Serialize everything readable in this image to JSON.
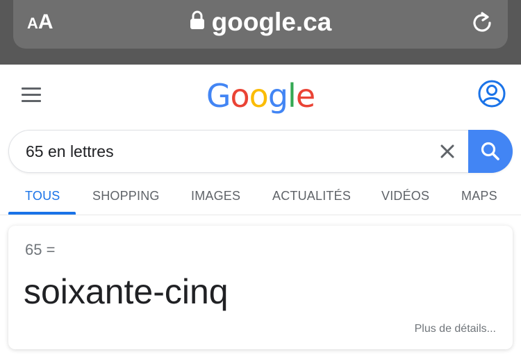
{
  "browser": {
    "text_size_label_small": "A",
    "text_size_label_big": "A",
    "url": "google.ca"
  },
  "header": {
    "logo_letters": [
      {
        "char": "G",
        "color": "#4285f4"
      },
      {
        "char": "o",
        "color": "#ea4335"
      },
      {
        "char": "o",
        "color": "#fbbc05"
      },
      {
        "char": "g",
        "color": "#4285f4"
      },
      {
        "char": "l",
        "color": "#34a853"
      },
      {
        "char": "e",
        "color": "#ea4335"
      }
    ]
  },
  "search": {
    "value": "65 en lettres"
  },
  "tabs": [
    {
      "label": "TOUS",
      "active": true
    },
    {
      "label": "SHOPPING",
      "active": false
    },
    {
      "label": "IMAGES",
      "active": false
    },
    {
      "label": "ACTUALITÉS",
      "active": false
    },
    {
      "label": "VIDÉOS",
      "active": false
    },
    {
      "label": "MAPS",
      "active": false
    }
  ],
  "result": {
    "query": "65 =",
    "answer": "soixante-cinq",
    "more_link": "Plus de détails..."
  },
  "colors": {
    "accent": "#1a73e8",
    "search_button": "#4285f4",
    "browser_bar": "#585858"
  }
}
